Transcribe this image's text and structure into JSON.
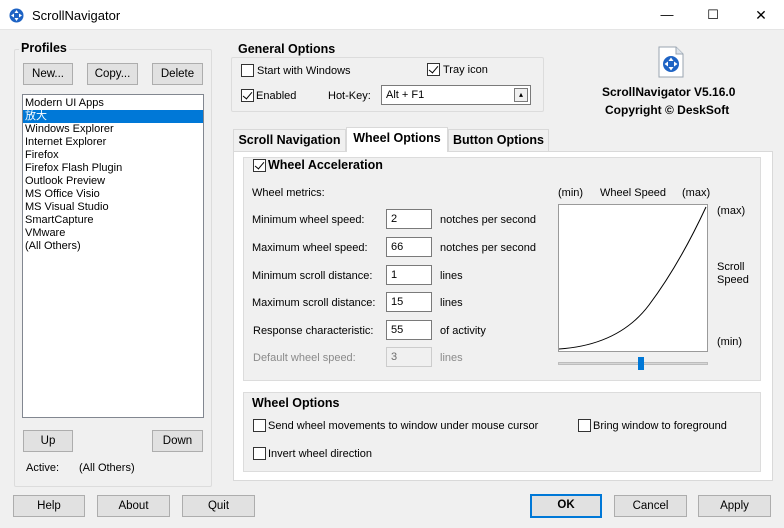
{
  "window": {
    "title": "ScrollNavigator",
    "minimize_glyph": "—",
    "maximize_glyph": "☐",
    "close_glyph": "✕"
  },
  "profiles": {
    "title": "Profiles",
    "new_label": "New...",
    "copy_label": "Copy...",
    "delete_label": "Delete",
    "items": [
      "Modern UI Apps",
      "放大",
      "Windows Explorer",
      "Internet Explorer",
      "Firefox",
      "Firefox Flash Plugin",
      "Outlook Preview",
      "MS Office Visio",
      "MS Visual Studio",
      "SmartCapture",
      "VMware",
      "(All Others)"
    ],
    "selected_index": 1,
    "up_label": "Up",
    "down_label": "Down",
    "active_label": "Active:",
    "active_value": "(All Others)"
  },
  "general": {
    "title": "General Options",
    "start_with_windows": "Start with Windows",
    "start_with_windows_checked": false,
    "tray_icon": "Tray icon",
    "tray_icon_checked": true,
    "enabled": "Enabled",
    "enabled_checked": true,
    "hotkey_label": "Hot-Key:",
    "hotkey_value": "Alt + F1"
  },
  "about_info": {
    "version": "ScrollNavigator V5.16.0",
    "copyright": "Copyright © DeskSoft"
  },
  "tabs": [
    "Scroll Navigation",
    "Wheel Options",
    "Button Options"
  ],
  "active_tab": 1,
  "wheel_acceleration": {
    "title": "Wheel Acceleration",
    "checked": true,
    "metrics_label": "Wheel metrics:",
    "rows": [
      {
        "label": "Minimum wheel speed:",
        "value": "2",
        "unit": "notches per second"
      },
      {
        "label": "Maximum wheel speed:",
        "value": "66",
        "unit": "notches per second"
      },
      {
        "label": "Minimum scroll distance:",
        "value": "1",
        "unit": "lines"
      },
      {
        "label": "Maximum scroll distance:",
        "value": "15",
        "unit": "lines"
      },
      {
        "label": "Response characteristic:",
        "value": "55",
        "unit": "of activity"
      },
      {
        "label": "Default wheel speed:",
        "value": "3",
        "unit": "lines",
        "disabled": true
      }
    ],
    "graph": {
      "x_min": "(min)",
      "x_title": "Wheel Speed",
      "x_max": "(max)",
      "y_max": "(max)",
      "y_title_1": "Scroll",
      "y_title_2": "Speed",
      "y_min": "(min)",
      "slider_value": 0.55
    }
  },
  "wheel_options": {
    "title": "Wheel Options",
    "send_under_cursor": "Send wheel movements to window under mouse cursor",
    "send_under_cursor_checked": false,
    "bring_to_foreground": "Bring window to foreground",
    "bring_to_foreground_checked": false,
    "invert": "Invert wheel direction",
    "invert_checked": false
  },
  "footer": {
    "help": "Help",
    "about": "About",
    "quit": "Quit",
    "ok": "OK",
    "cancel": "Cancel",
    "apply": "Apply"
  }
}
